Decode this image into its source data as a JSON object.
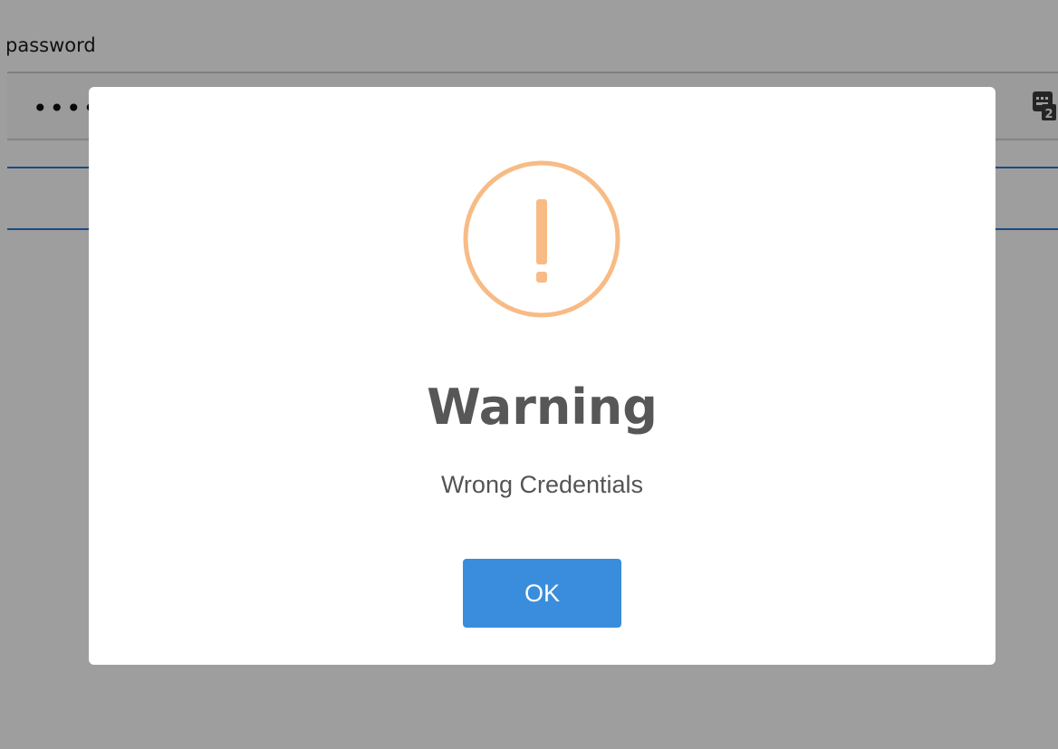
{
  "form": {
    "password_label": "password",
    "password_value": "••••",
    "keyboard_icon": "virtual-keyboard-icon"
  },
  "dialog": {
    "icon": "warning-icon",
    "icon_color": "#f8bb86",
    "title": "Warning",
    "message": "Wrong Credentials",
    "confirm_label": "OK",
    "confirm_color": "#3a8ddc"
  }
}
